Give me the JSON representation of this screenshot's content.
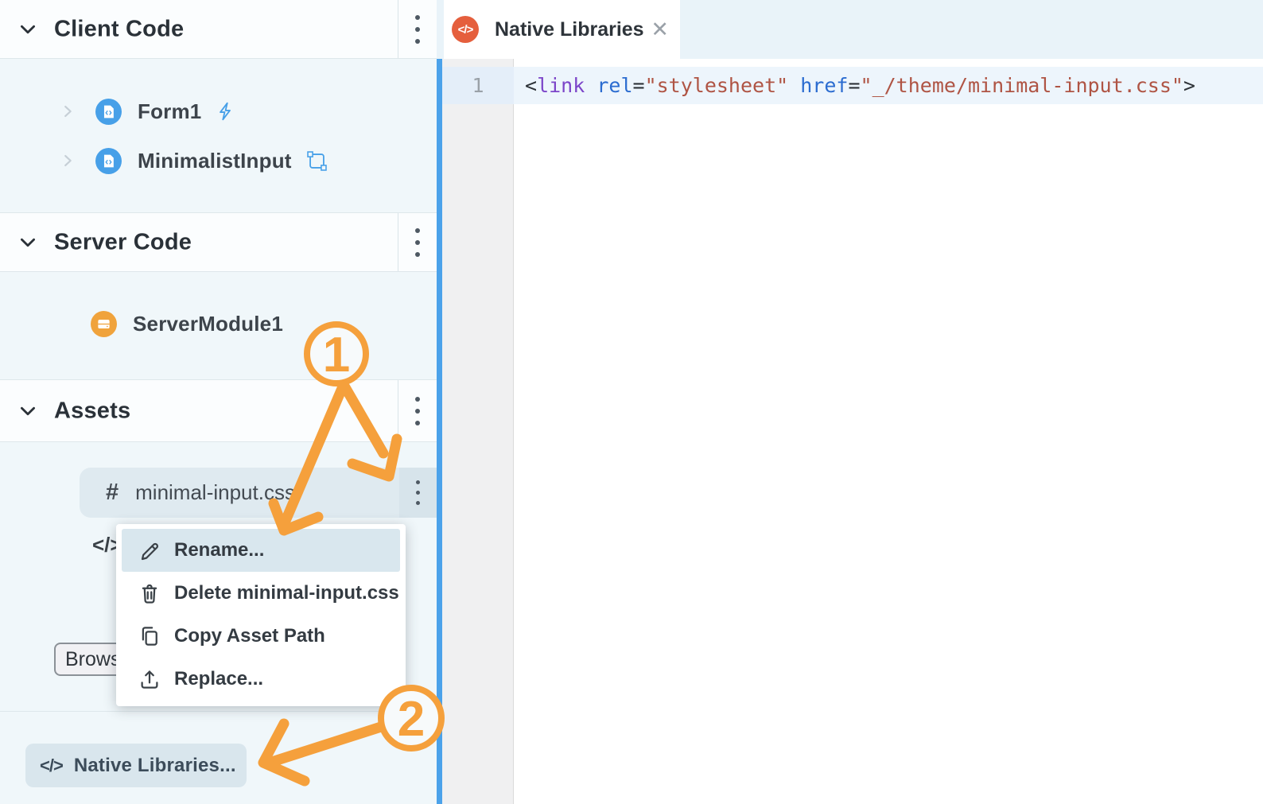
{
  "sidebar": {
    "sections": [
      {
        "title": "Client Code"
      },
      {
        "title": "Server Code"
      },
      {
        "title": "Assets"
      }
    ],
    "items": {
      "form1": "Form1",
      "minimalist_input": "MinimalistInput",
      "server_module": "ServerModule1",
      "asset_css": "minimal-input.css",
      "asset_hash_glyph": "#",
      "hidden_code_glyph": "</>"
    },
    "browse_button_label": "Browse...",
    "native_libraries_button_label": "Native Libraries...",
    "native_libraries_icon_glyph": "</>"
  },
  "context_menu": {
    "items": [
      {
        "label": "Rename..."
      },
      {
        "label": "Delete minimal-input.css"
      },
      {
        "label": "Copy Asset Path"
      },
      {
        "label": "Replace..."
      }
    ]
  },
  "editor_tab": {
    "title": "Native Libraries",
    "close_glyph": "✕",
    "icon_glyph": "</>"
  },
  "editor": {
    "line_number": "1",
    "tokens": [
      "<",
      "link",
      " ",
      "rel",
      "=",
      "\"stylesheet\"",
      " ",
      "href",
      "=",
      "\"_/theme/minimal-input.css\"",
      ">"
    ]
  },
  "annotations": {
    "step1": "1",
    "step2": "2",
    "accent": "#F5A03C"
  }
}
